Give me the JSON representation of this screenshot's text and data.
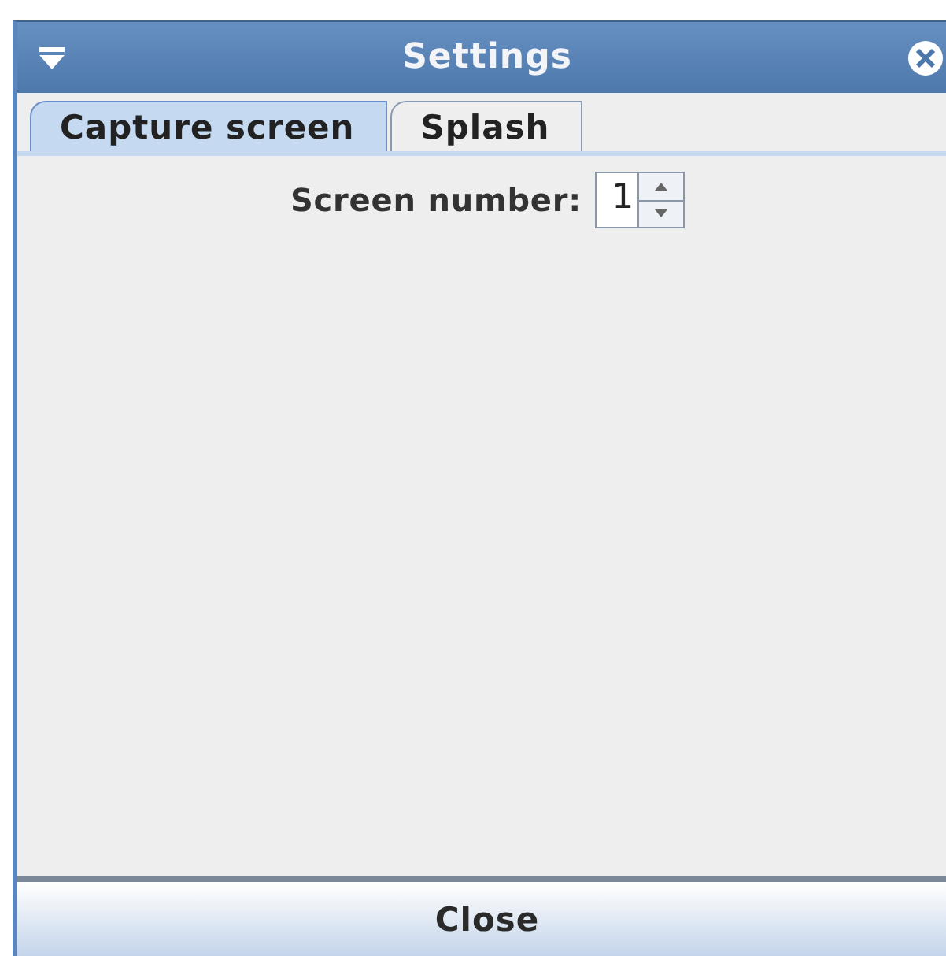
{
  "window": {
    "title": "Settings"
  },
  "tabs": [
    {
      "label": "Capture screen",
      "selected": true
    },
    {
      "label": "Splash",
      "selected": false
    }
  ],
  "screen_number": {
    "label": "Screen number:",
    "value": "1"
  },
  "buttons": [
    "Close"
  ]
}
